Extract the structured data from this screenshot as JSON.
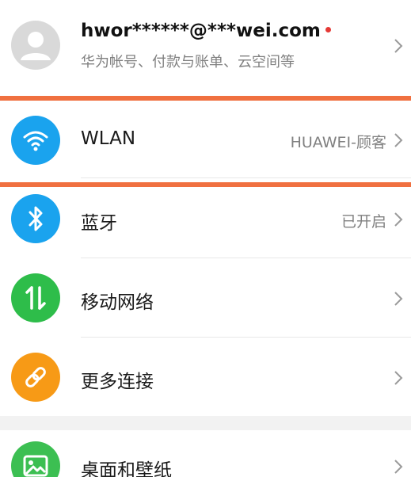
{
  "account": {
    "email": "hwor******@***wei.com",
    "subtitle": "华为帐号、付款与账单、云空间等",
    "avatar_color": "#d9d9d9",
    "notification_dot_color": "#e53935"
  },
  "settings": [
    {
      "label": "WLAN",
      "value": "HUAWEI-顾客",
      "icon": "wifi-icon",
      "color": "#1aa3ee"
    },
    {
      "label": "蓝牙",
      "value": "已开启",
      "icon": "bluetooth-icon",
      "color": "#1aa3ee"
    },
    {
      "label": "移动网络",
      "value": "",
      "icon": "mobile-network-icon",
      "color": "#2ebd4a"
    },
    {
      "label": "更多连接",
      "value": "",
      "icon": "link-icon",
      "color": "#f79a16"
    },
    {
      "label": "桌面和壁纸",
      "value": "",
      "icon": "wallpaper-icon",
      "color": "#3cbf52"
    }
  ],
  "highlight_color": "#f07040"
}
